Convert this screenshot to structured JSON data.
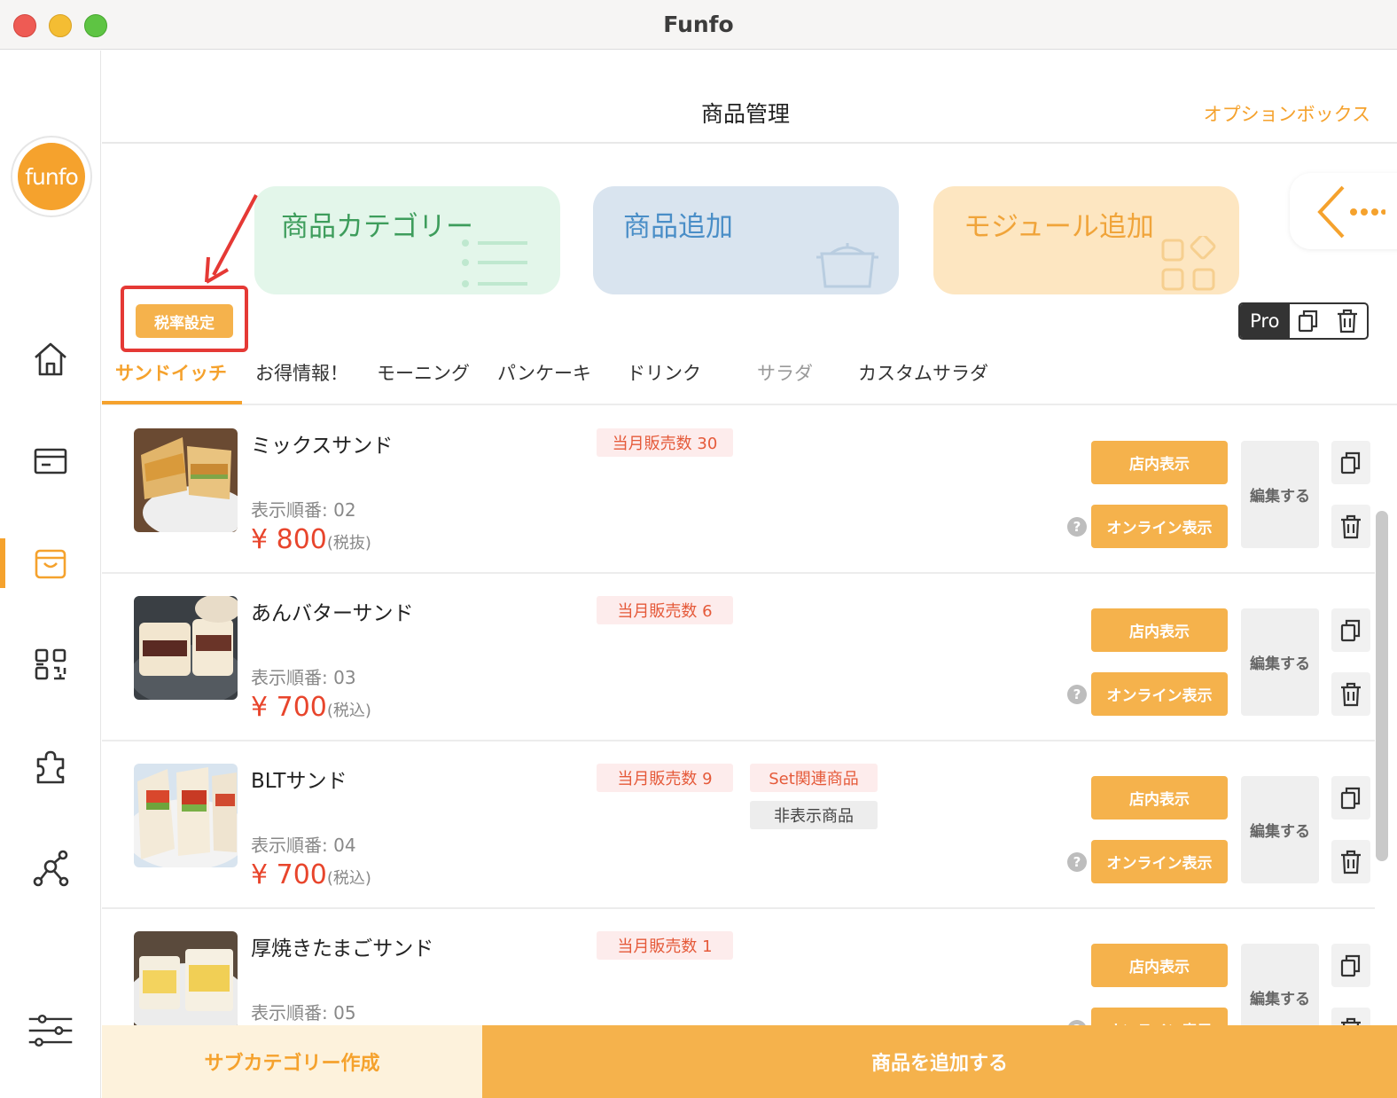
{
  "window": {
    "title": "Funfo"
  },
  "logo": {
    "text": "funfo"
  },
  "header": {
    "title": "商品管理",
    "option_box": "オプションボックス"
  },
  "cards": {
    "category": "商品カテゴリー",
    "add_product": "商品追加",
    "add_module": "モジュール追加"
  },
  "tax_button": "税率設定",
  "pro_label": "Pro",
  "tabs": [
    "サンドイッチ",
    "お得情報！",
    "モーニング",
    "パンケーキ",
    "ドリンク",
    "サラダ",
    "カスタムサラダ"
  ],
  "products": [
    {
      "name": "ミックスサンド",
      "sales": "当月販売数 30",
      "order": "表示順番: 02",
      "price": "¥ 800",
      "tax": "(税抜)"
    },
    {
      "name": "あんバターサンド",
      "sales": "当月販売数 6",
      "order": "表示順番: 03",
      "price": "¥ 700",
      "tax": "(税込)"
    },
    {
      "name": "BLTサンド",
      "sales": "当月販売数 9",
      "set_badge": "Set関連商品",
      "hidden_badge": "非表示商品",
      "order": "表示順番: 04",
      "price": "¥ 700",
      "tax": "(税込)"
    },
    {
      "name": "厚焼きたまごサンド",
      "sales": "当月販売数 1",
      "order": "表示順番: 05",
      "price": "",
      "tax": ""
    }
  ],
  "row_buttons": {
    "store": "店内表示",
    "online": "オンライン表示",
    "edit": "編集する",
    "help": "?"
  },
  "footer": {
    "subcategory": "サブカテゴリー作成",
    "add_product": "商品を追加する"
  },
  "colors": {
    "accent": "#f5a22d",
    "button": "#f5b24c",
    "price": "#e8452c",
    "highlight": "#e53935"
  }
}
